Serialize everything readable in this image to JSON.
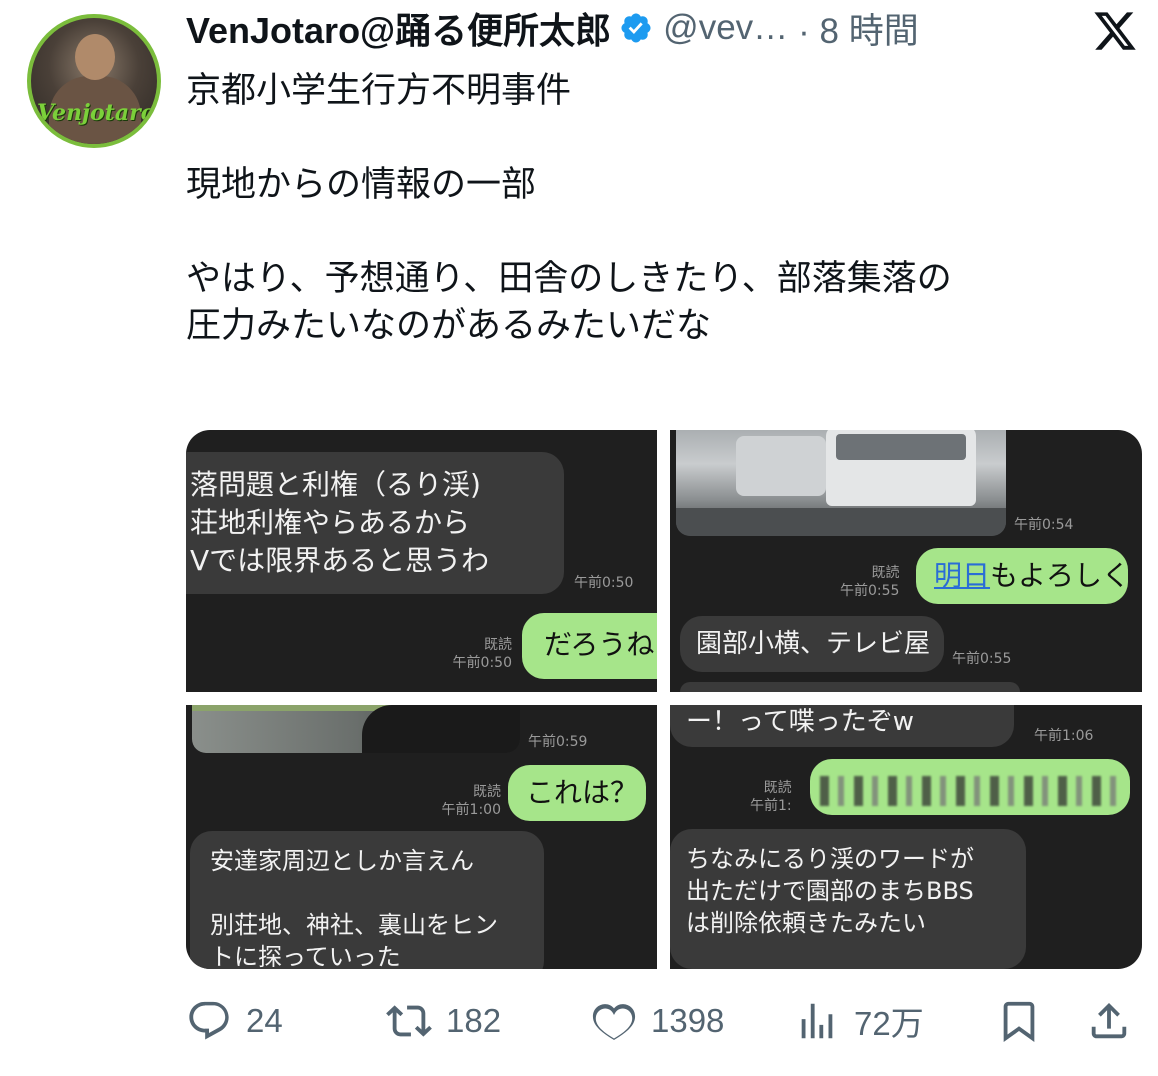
{
  "author": {
    "name": "VenJotaro@踊る便所太郎",
    "handle": "@vev…",
    "time": "· 8 時間",
    "avatar_text": "Venjotaro"
  },
  "post": {
    "lines": [
      "京都小学生行方不明事件",
      "",
      "現地からの情報の一部",
      "",
      "やはり、予想通り、田舎のしきたり、部落集落の",
      "圧力みたいなのがあるみたいだな"
    ]
  },
  "media": {
    "tile1": {
      "msg_line1": "落問題と利権（るり渓)",
      "msg_line2": "荘地利権やらあるから",
      "msg_line3": "Vでは限界あると思うわ",
      "msg_time": "午前0:50",
      "read_label": "既読",
      "reply_time": "午前0:50",
      "reply": "だろうね"
    },
    "tile2": {
      "photo_time": "午前0:54",
      "read_label": "既読",
      "reply_time": "午前0:55",
      "reply_link": "明日",
      "reply_rest": "もよろしく",
      "msg": "園部小横、テレビ屋",
      "msg_time": "午前0:55"
    },
    "tile3": {
      "photo_time": "午前0:59",
      "read_label": "既読",
      "reply_time": "午前1:00",
      "reply": "これは？",
      "msg_line1": "安達家周辺としか言えん",
      "msg_line2": "別荘地、神社、裏山をヒン",
      "msg_line3": "トに探っていった"
    },
    "tile4": {
      "msg_top": "ー！って喋ったぞw",
      "msg_top_time": "午前1:06",
      "read_label": "既読",
      "reply_time": "午前1:",
      "msg_line1": "ちなみにるり渓のワードが",
      "msg_line2": "出ただけで園部のまちBBS",
      "msg_line3": "は削除依頼きたみたい"
    }
  },
  "actions": {
    "replies": "24",
    "reposts": "182",
    "likes": "1398",
    "views": "72万"
  },
  "colors": {
    "accent": "#1d9bf0",
    "text_secondary": "#536471",
    "line_green": "#a6e58a",
    "chat_bg": "#1f1f1f"
  }
}
